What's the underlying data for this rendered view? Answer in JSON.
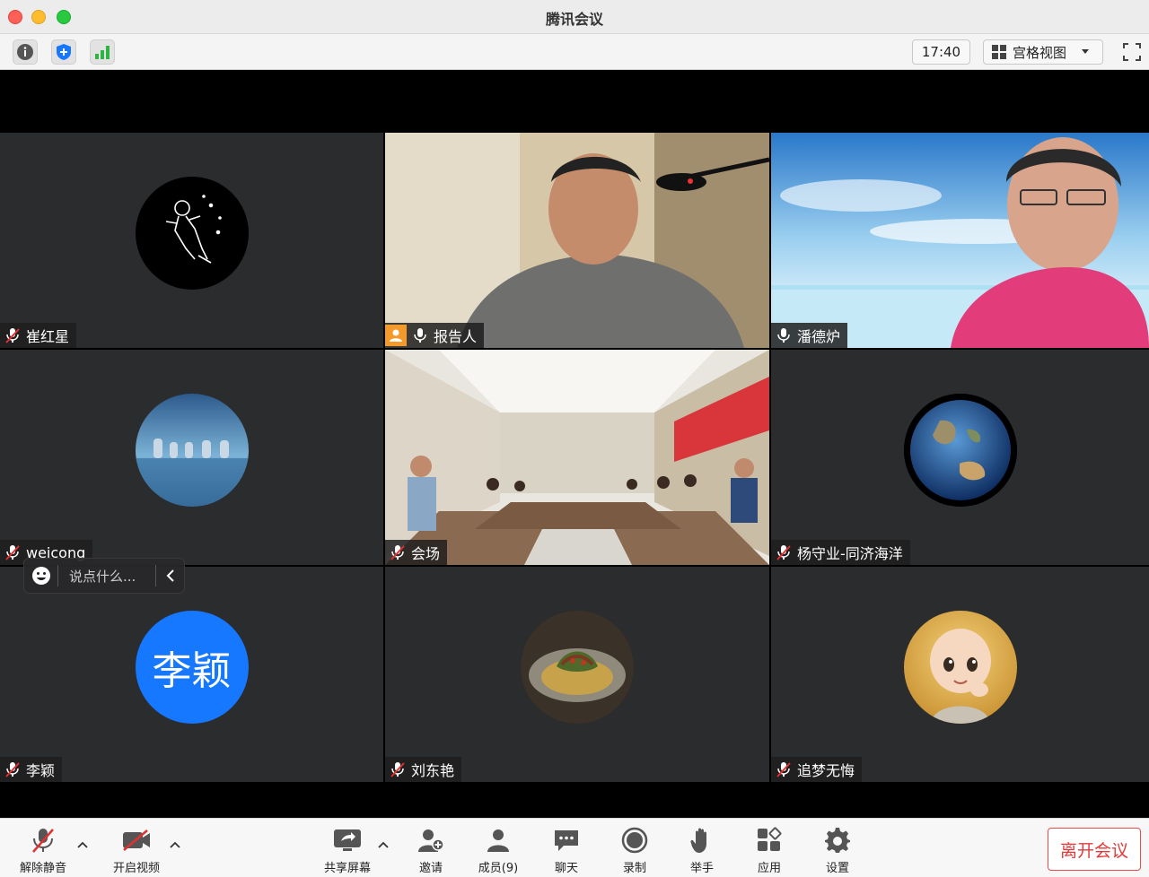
{
  "window": {
    "title": "腾讯会议"
  },
  "toolbar": {
    "time": "17:40",
    "view_mode": "宫格视图"
  },
  "tiles": [
    {
      "name": "崔红星",
      "mic": "muted",
      "type": "avatar",
      "avatar": "astronaut-icon"
    },
    {
      "name": "报告人",
      "mic": "on",
      "type": "video",
      "host": true,
      "active": true
    },
    {
      "name": "潘德炉",
      "mic": "on",
      "type": "video"
    },
    {
      "name": "weicong",
      "mic": "muted",
      "type": "avatar",
      "avatar": "city-skyline-photo"
    },
    {
      "name": "会场",
      "mic": "muted",
      "type": "video"
    },
    {
      "name": "杨守业-同济海洋",
      "mic": "muted",
      "type": "avatar",
      "avatar": "earth-globe-photo"
    },
    {
      "name": "李颖",
      "mic": "muted",
      "type": "avatar",
      "avatar_text": "李颖",
      "avatar_color": "#1677ff"
    },
    {
      "name": "刘东艳",
      "mic": "muted",
      "type": "avatar",
      "avatar": "food-dish-photo"
    },
    {
      "name": "追梦无悔",
      "mic": "muted",
      "type": "avatar",
      "avatar": "cartoon-monk-photo"
    }
  ],
  "chat": {
    "placeholder": "说点什么..."
  },
  "bottom": {
    "unmute": "解除静音",
    "start_video": "开启视频",
    "share_screen": "共享屏幕",
    "invite": "邀请",
    "members": "成员(9)",
    "chat": "聊天",
    "record": "录制",
    "raise_hand": "举手",
    "apps": "应用",
    "settings": "设置",
    "leave": "离开会议"
  },
  "colors": {
    "active_border": "#2ecc71",
    "leave": "#e23a3a",
    "mute_red": "#e03030",
    "shield": "#1677ff",
    "signal": "#2fb344"
  }
}
